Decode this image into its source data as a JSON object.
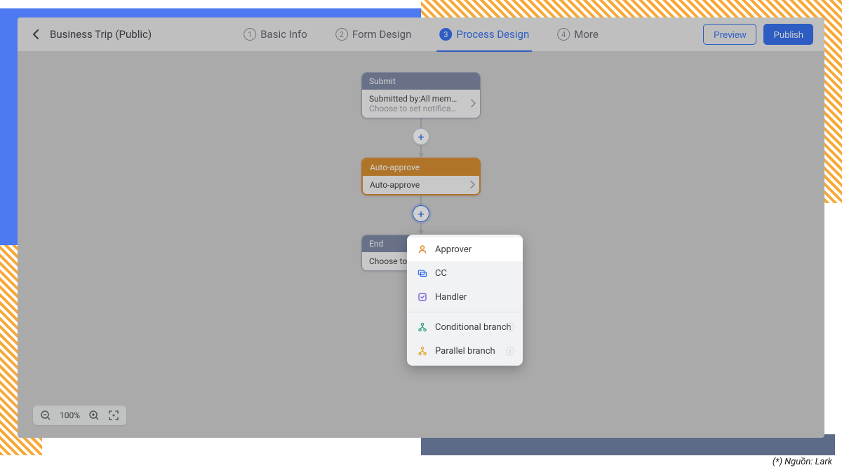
{
  "header": {
    "title": "Business Trip (Public)",
    "steps": [
      {
        "num": "1",
        "label": "Basic Info"
      },
      {
        "num": "2",
        "label": "Form Design"
      },
      {
        "num": "3",
        "label": "Process Design"
      },
      {
        "num": "4",
        "label": "More"
      }
    ],
    "active_step_index": 2,
    "preview_label": "Preview",
    "publish_label": "Publish"
  },
  "flow": {
    "submit": {
      "title": "Submit",
      "line1": "Submitted by:All mem…",
      "line2": "Choose to set notifica…"
    },
    "auto_approve": {
      "title": "Auto-approve",
      "line1": "Auto-approve"
    },
    "end": {
      "title": "End",
      "line1": "Choose to set no"
    }
  },
  "popup": {
    "items": [
      {
        "label": "Approver",
        "icon": "user-icon",
        "color": "#e28a2a",
        "hovered": true,
        "help": false
      },
      {
        "label": "CC",
        "icon": "cc-icon",
        "color": "#2f6bed",
        "hovered": false,
        "help": false
      },
      {
        "label": "Handler",
        "icon": "handler-icon",
        "color": "#7a5fd6",
        "hovered": false,
        "help": false
      },
      {
        "label": "Conditional branch",
        "icon": "branch-cond-icon",
        "color": "#2aa07a",
        "hovered": false,
        "help": true,
        "sep_before": true
      },
      {
        "label": "Parallel branch",
        "icon": "branch-par-icon",
        "color": "#e2a52a",
        "hovered": false,
        "help": true
      }
    ]
  },
  "zoom": {
    "value": "100%"
  },
  "credit": "(*) Nguồn: Lark"
}
